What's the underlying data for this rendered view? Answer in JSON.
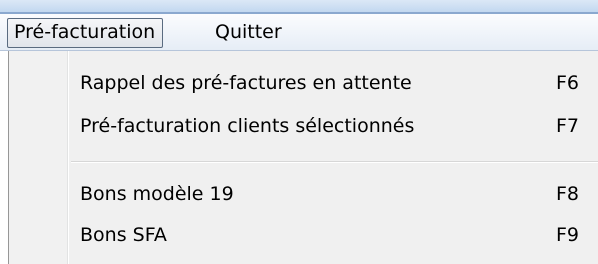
{
  "menubar": {
    "items": [
      {
        "label": "Pré-facturation"
      },
      {
        "label": "Quitter"
      }
    ]
  },
  "dropdown": {
    "items": [
      {
        "label": "Rappel des pré-factures en attente",
        "shortcut": "F6"
      },
      {
        "label": "Pré-facturation clients sélectionnés",
        "shortcut": "F7"
      },
      {
        "label": "Bons modèle 19",
        "shortcut": "F8"
      },
      {
        "label": "Bons SFA",
        "shortcut": "F9"
      }
    ]
  },
  "colors": {
    "menubar_background": "#e6edf6",
    "menu_background": "#f0f0f0",
    "active_border": "#5a6b80"
  }
}
